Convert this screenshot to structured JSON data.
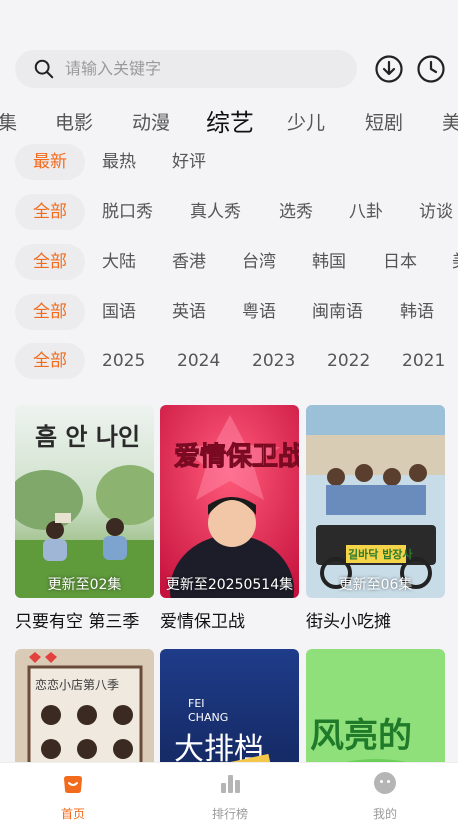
{
  "search": {
    "placeholder": "请输入关键字"
  },
  "category_tabs": [
    {
      "label": "集"
    },
    {
      "label": "电影"
    },
    {
      "label": "动漫"
    },
    {
      "label": "综艺"
    },
    {
      "label": "少儿"
    },
    {
      "label": "短剧"
    },
    {
      "label": "美"
    }
  ],
  "filters": {
    "sort": [
      "最新",
      "最热",
      "好评"
    ],
    "type": [
      "全部",
      "脱口秀",
      "真人秀",
      "选秀",
      "八卦",
      "访谈"
    ],
    "region": [
      "全部",
      "大陆",
      "香港",
      "台湾",
      "韩国",
      "日本",
      "美"
    ],
    "language": [
      "全部",
      "国语",
      "英语",
      "粤语",
      "闽南语",
      "韩语"
    ],
    "year": [
      "全部",
      "2025",
      "2024",
      "2023",
      "2022",
      "2021"
    ]
  },
  "cards": [
    {
      "title": "只要有空 第三季",
      "badge": "更新至02集",
      "poster_text": "흠 안 나인"
    },
    {
      "title": "爱情保卫战",
      "badge": "更新至20250514集",
      "poster_text": "爱情保卫战"
    },
    {
      "title": "街头小吃摊",
      "badge": "更新至06集",
      "poster_text": "길바닥 밥장사"
    },
    {
      "title": "",
      "badge": "",
      "poster_text": "恋恋小店第八季"
    },
    {
      "title": "",
      "badge": "",
      "poster_text": "大排档"
    },
    {
      "title": "",
      "badge": "",
      "poster_text": "风亮的"
    }
  ],
  "bottom_nav": [
    {
      "label": "首页"
    },
    {
      "label": "排行榜"
    },
    {
      "label": "我的"
    }
  ],
  "colors": {
    "accent": "#f26b1d",
    "background": "#f4f4f6"
  }
}
